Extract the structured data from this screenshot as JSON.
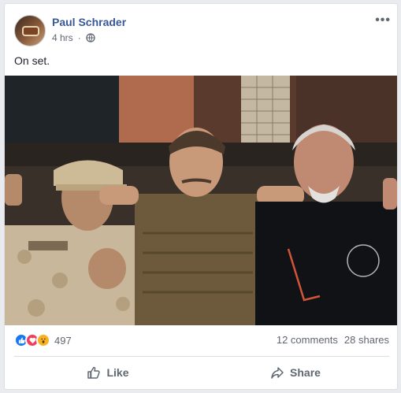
{
  "post": {
    "author": "Paul Schrader",
    "timestamp": "4 hrs",
    "privacy_icon": "globe-icon",
    "more_label": "•••",
    "text": "On set.",
    "photo_alt": "Three men posing together on a film set"
  },
  "reactions": {
    "types": [
      "like",
      "love",
      "wow"
    ],
    "count": "497",
    "comments": "12 comments",
    "shares": "28 shares"
  },
  "actions": {
    "like_label": "Like",
    "share_label": "Share"
  },
  "colors": {
    "author_link": "#385898",
    "like_blue": "#1877f2",
    "love_red": "#f33e58",
    "wow_yellow": "#f7b125",
    "muted_text": "#606770"
  }
}
